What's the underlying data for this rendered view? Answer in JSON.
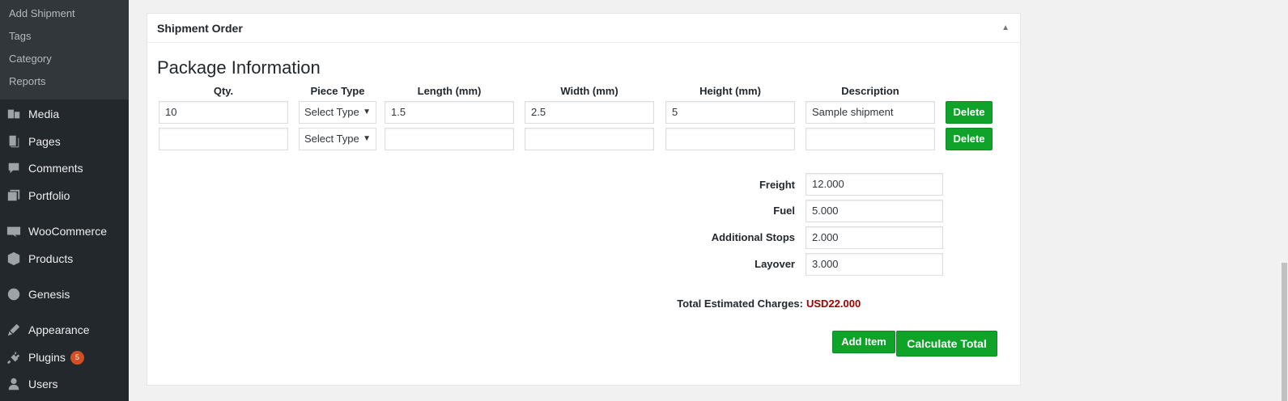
{
  "sidebar": {
    "submenu": [
      "Add Shipment",
      "Tags",
      "Category",
      "Reports"
    ],
    "menu": [
      {
        "label": "Media",
        "icon": "media-icon"
      },
      {
        "label": "Pages",
        "icon": "pages-icon"
      },
      {
        "label": "Comments",
        "icon": "comments-icon"
      },
      {
        "label": "Portfolio",
        "icon": "portfolio-icon"
      },
      {
        "label": "WooCommerce",
        "icon": "woocommerce-icon"
      },
      {
        "label": "Products",
        "icon": "products-icon"
      },
      {
        "label": "Genesis",
        "icon": "genesis-icon"
      },
      {
        "label": "Appearance",
        "icon": "appearance-icon"
      },
      {
        "label": "Plugins",
        "icon": "plugins-icon",
        "badge": "5"
      },
      {
        "label": "Users",
        "icon": "users-icon"
      }
    ]
  },
  "panel": {
    "title": "Shipment Order",
    "section_title": "Package Information"
  },
  "table": {
    "headers": [
      "Qty.",
      "Piece Type",
      "Length (mm)",
      "Width (mm)",
      "Height (mm)",
      "Description"
    ],
    "rows": [
      {
        "qty": "10",
        "piece_type": "Select Type",
        "length": "1.5",
        "width": "2.5",
        "height": "5",
        "description": "Sample shipment",
        "delete": "Delete"
      },
      {
        "qty": "",
        "piece_type": "Select Type",
        "length": "",
        "width": "",
        "height": "",
        "description": "",
        "delete": "Delete"
      }
    ]
  },
  "charges": {
    "freight_label": "Freight",
    "freight": "12.000",
    "fuel_label": "Fuel",
    "fuel": "5.000",
    "stops_label": "Additional Stops",
    "stops": "2.000",
    "layover_label": "Layover",
    "layover": "3.000",
    "total_label": "Total Estimated Charges:",
    "total": "USD22.000",
    "total_color": "#a00000"
  },
  "actions": {
    "add_item": "Add Item",
    "calculate": "Calculate Total"
  },
  "colors": {
    "sidebar_bg": "#23282d",
    "submenu_bg": "#32373c",
    "button_green": "#0fa32a",
    "badge": "#d54e21"
  }
}
